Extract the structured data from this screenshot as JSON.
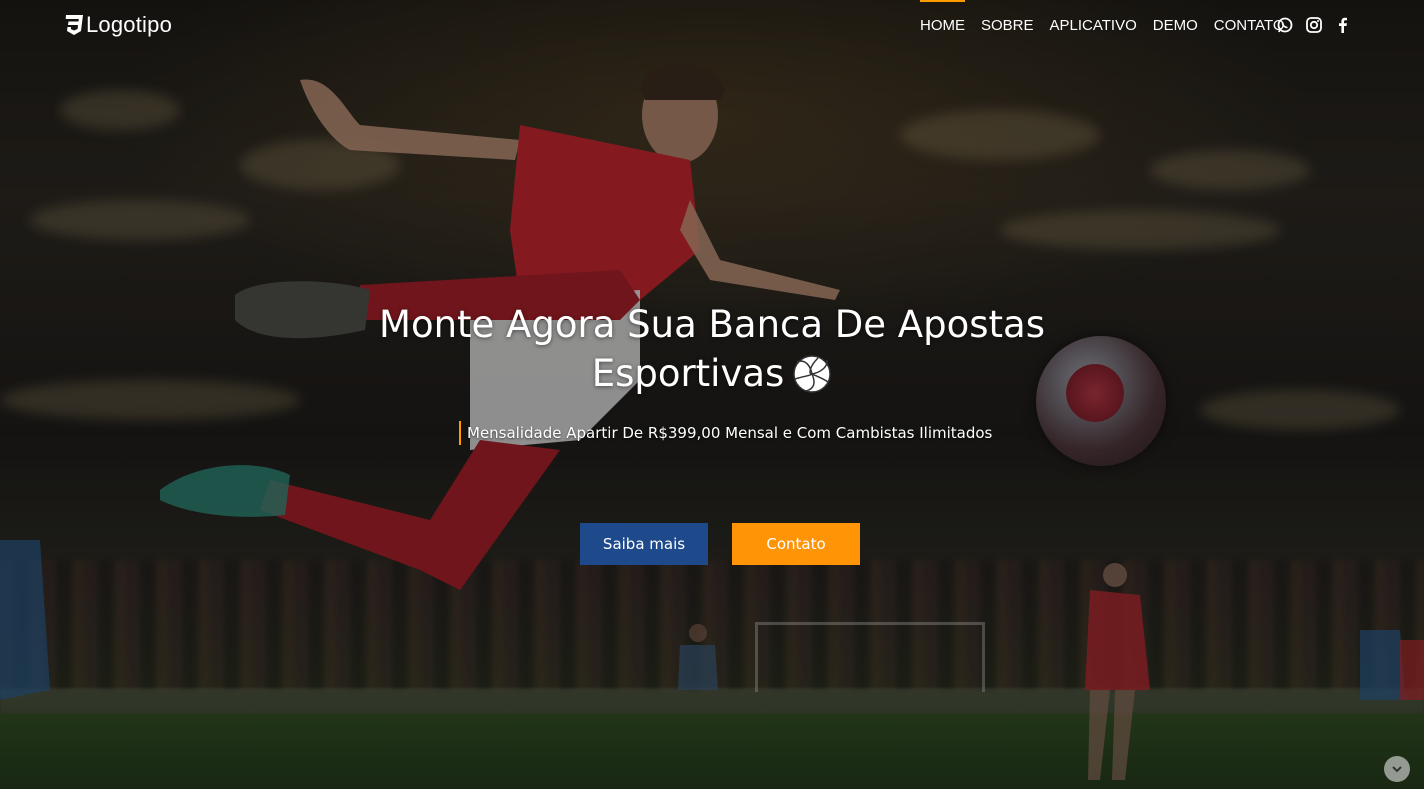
{
  "header": {
    "logo_text": "Logotipo",
    "nav": [
      {
        "label": "HOME",
        "active": true
      },
      {
        "label": "SOBRE",
        "active": false
      },
      {
        "label": "APLICATIVO",
        "active": false
      },
      {
        "label": "DEMO",
        "active": false
      },
      {
        "label": "CONTATO",
        "active": false
      }
    ],
    "social_icons": [
      "whatsapp-icon",
      "instagram-icon",
      "facebook-icon"
    ]
  },
  "hero": {
    "title_line1": "Monte Agora Sua Banca De Apostas",
    "title_line2": "Esportivas",
    "title_emoji": "volleyball-icon",
    "subtitle": "Mensalidade Apartir De R$399,00 Mensal e Com Cambistas Ilimitados",
    "buttons": {
      "primary": "Saiba mais",
      "secondary": "Contato"
    }
  },
  "colors": {
    "accent_orange": "#ff9406",
    "primary_blue": "#1e4a8c"
  }
}
